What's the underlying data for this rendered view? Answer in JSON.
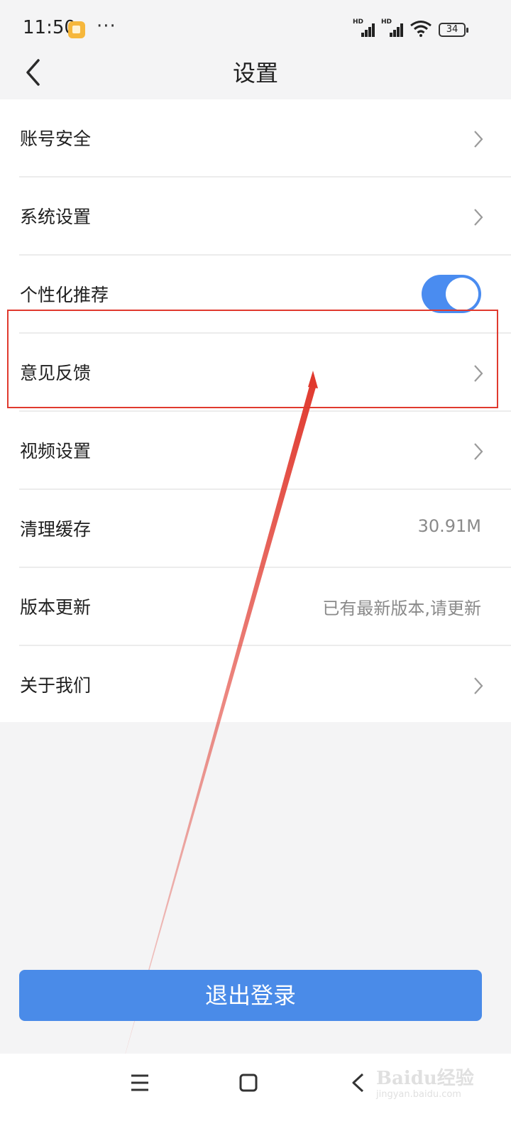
{
  "status_bar": {
    "time": "11:50",
    "more": "···",
    "hd": "HD",
    "battery": "34"
  },
  "header": {
    "title": "设置"
  },
  "settings": {
    "items": [
      {
        "label": "账号安全"
      },
      {
        "label": "系统设置"
      },
      {
        "label": "个性化推荐",
        "toggle_on": true
      },
      {
        "label": "意见反馈"
      },
      {
        "label": "视频设置"
      },
      {
        "label": "清理缓存",
        "value": "30.91M"
      },
      {
        "label": "版本更新",
        "value": "已有最新版本,请更新"
      },
      {
        "label": "关于我们"
      }
    ]
  },
  "logout_button": "退出登录",
  "watermark": {
    "brand": "Baidu经验",
    "sub": "jingyan.baidu.com"
  },
  "colors": {
    "accent": "#4a8be8",
    "toggle": "#4a8cf0",
    "annotation": "#e0392e"
  },
  "icons": [
    "app-notification-icon",
    "signal-icon",
    "wifi-icon",
    "battery-icon",
    "back-icon",
    "chevron-right-icon",
    "menu-icon",
    "home-icon",
    "nav-back-icon"
  ]
}
